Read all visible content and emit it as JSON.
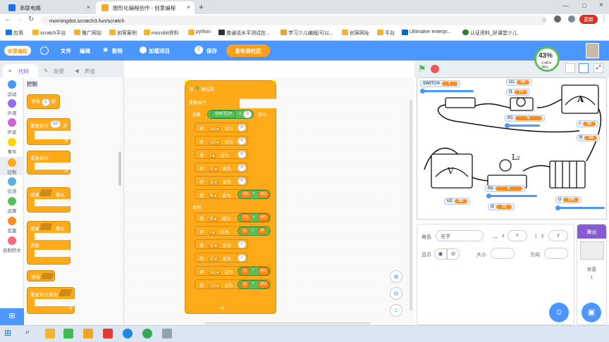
{
  "browser": {
    "tabs": [
      {
        "title": "串联电路",
        "color": "#f4b400"
      },
      {
        "title": "图形化编程创作 - 创意编程",
        "color": "#f9a825"
      }
    ],
    "url": "morningdot.scratch3.fun/scratch",
    "update_label": "更新",
    "bookmarks": [
      "应用",
      "scratch平台",
      "推广网站",
      "创客案例",
      "microbit资料",
      "python",
      "普通话水平测试在...",
      "学习少儿编程|可以...",
      "创客网址",
      "平台",
      "Ultimaker enterpr...",
      "认证资料_好课堂少儿"
    ]
  },
  "menubar": {
    "logo": "创意编程",
    "items": [
      "文件",
      "编辑",
      "教程",
      "加载项目",
      "保存"
    ],
    "community": "发布到社区",
    "cpu_percent": "43%",
    "cpu_speed": "2.4K/s",
    "cpu_speed_up": "0K/s"
  },
  "editor_tabs": [
    "代码",
    "背景",
    "声音"
  ],
  "categories": [
    {
      "label": "运动",
      "color": "#4c97ff"
    },
    {
      "label": "外观",
      "color": "#9966ff"
    },
    {
      "label": "声音",
      "color": "#cf63cf"
    },
    {
      "label": "事件",
      "color": "#ffd500"
    },
    {
      "label": "控制",
      "color": "#ffab19"
    },
    {
      "label": "侦测",
      "color": "#5cb1d6"
    },
    {
      "label": "运算",
      "color": "#59c059"
    },
    {
      "label": "变量",
      "color": "#ff8c1a"
    },
    {
      "label": "自制积木",
      "color": "#ff6680"
    }
  ],
  "palette": {
    "section": "控制",
    "wait": "等待",
    "wait_val": "1",
    "wait_unit": "秒",
    "repeat": "重复执行",
    "repeat_val": "10",
    "repeat_unit": "次",
    "forever": "重复执行",
    "if": "如果",
    "then": "那么",
    "if2": "如果",
    "then2": "那么",
    "else": "否则",
    "wait_until": "等待",
    "repeat_until": "重复执行直到"
  },
  "script": {
    "hat": "当",
    "hat_tail": "被点击",
    "forever": "重复执行",
    "if": "如果",
    "switch": "SWITCH",
    "eq": "=",
    "zero": "0",
    "then": "那么",
    "set": "将",
    "to": "设为",
    "if_rows": [
      {
        "var": "U1",
        "val": "0"
      },
      {
        "var": "U2",
        "val": "0"
      },
      {
        "var": "I",
        "val": "0"
      },
      {
        "var": "I1",
        "val": "0"
      },
      {
        "var": "I2",
        "val": "0"
      },
      {
        "var": "R",
        "a": "R1",
        "op": "+",
        "b": "R2"
      }
    ],
    "else": "否则",
    "else_rows": [
      {
        "var": "R",
        "a": "R1",
        "op": "+",
        "b": "R2"
      },
      {
        "var": "I",
        "a": "U",
        "op": "/",
        "b": "R"
      },
      {
        "var": "I1",
        "val": "I"
      },
      {
        "var": "I2",
        "val": "I"
      },
      {
        "var": "U1",
        "a": "I1",
        "op": "*",
        "b": "R1"
      },
      {
        "var": "U2",
        "a": "I2",
        "op": "*",
        "b": "R2"
      }
    ]
  },
  "stage": {
    "monitors": [
      {
        "name": "SWITCH",
        "value": "1"
      },
      {
        "name": "U1",
        "value": "50"
      },
      {
        "name": "I1",
        "value": "10"
      },
      {
        "name": "R1",
        "value": "5"
      },
      {
        "name": "I",
        "value": "10"
      },
      {
        "name": "R",
        "value": "10"
      },
      {
        "name": "R2",
        "value": "5"
      },
      {
        "name": "U2",
        "value": "20"
      },
      {
        "name": "I2",
        "value": "10"
      },
      {
        "name": "U",
        "value": "100"
      }
    ],
    "meter_label_a": "A",
    "meter_label_v": "V",
    "bulb_label": "L₂"
  },
  "sprite": {
    "role_label": "角色",
    "role_value": "名字",
    "x_label": "x",
    "x_value": "x",
    "y_label": "y",
    "y_value": "y",
    "show_label": "显示",
    "size_label": "大小",
    "dir_label": "方向"
  },
  "stage_panel": {
    "title": "舞台",
    "backdrop_label": "背景",
    "backdrop_count": "1"
  }
}
